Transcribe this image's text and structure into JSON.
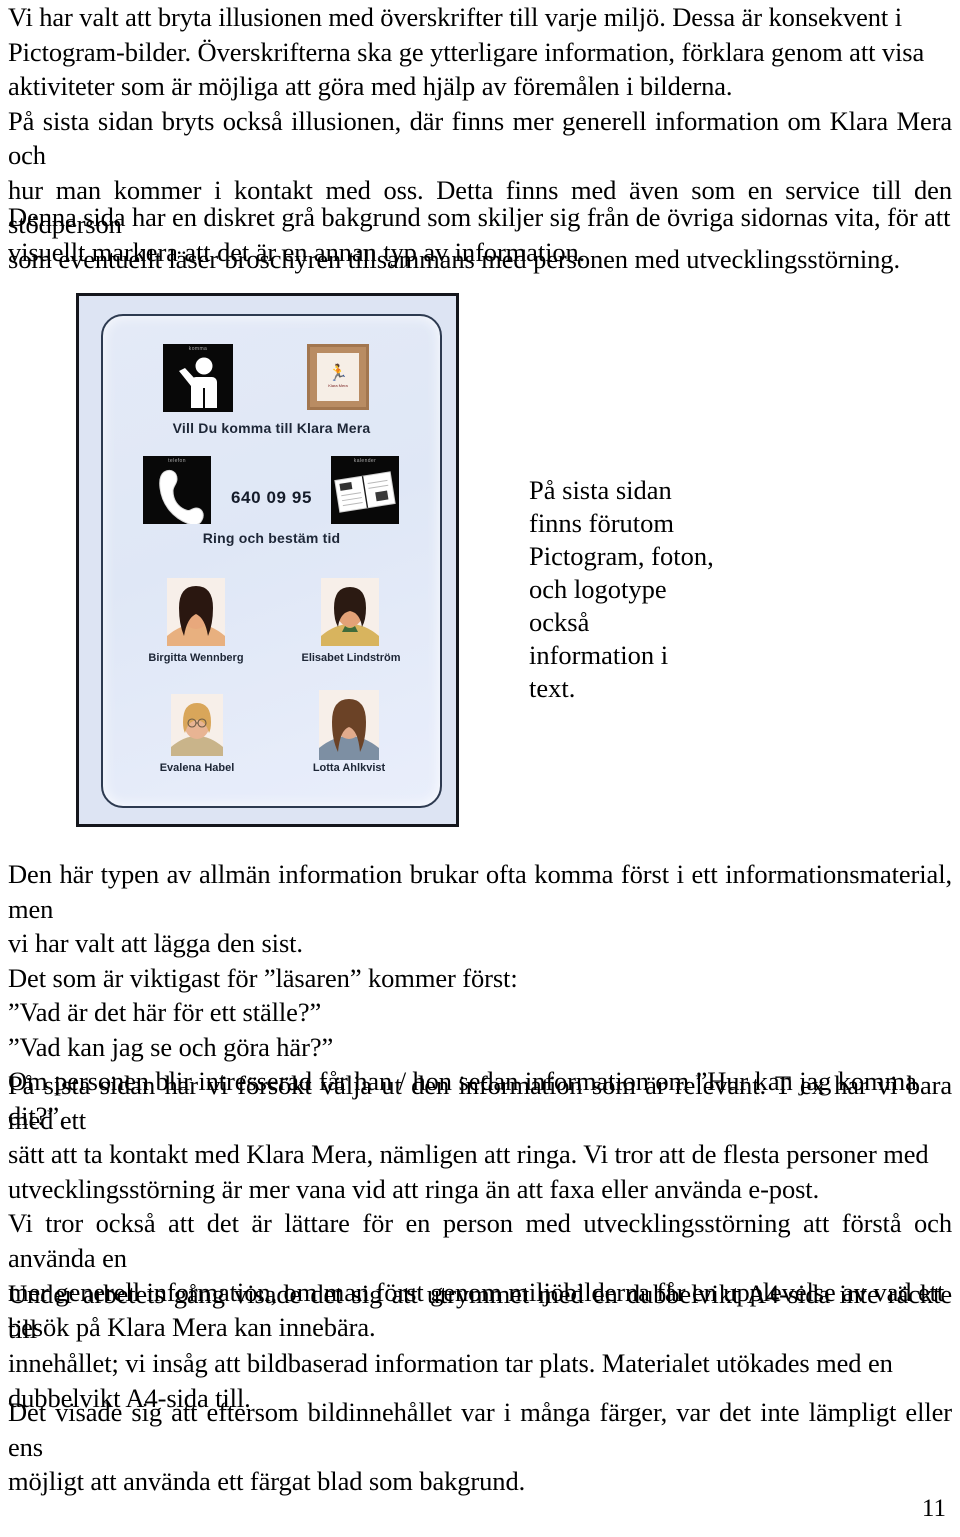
{
  "document": {
    "page_number": "11",
    "paragraphs": {
      "intro": [
        "Vi har valt att bryta illusionen med överskrifter till varje miljö. Dessa är konsekvent i",
        "Pictogram-bilder. Överskrifterna ska ge ytterligare information, förklara genom att visa",
        "aktiviteter som är möjliga att göra med hjälp av föremålen i bilderna.",
        "På sista sidan bryts också illusionen, där finns mer generell information om Klara Mera och",
        "hur man kommer i kontakt med oss. Detta finns med även som en service till den stödperson",
        "som eventuellt läser broschyren tillsammans med personen med utvecklingsstörning."
      ],
      "gray_background": [
        "Denna sida har en diskret grå bakgrund som skiljer sig från de övriga sidornas vita, för att",
        "visuellt markera att det är en annan typ av information."
      ],
      "reader_first": [
        "Den här typen av allmän information brukar ofta komma först i ett informationsmaterial, men",
        "vi har valt att lägga den sist.",
        "Det som är viktigast för ”läsaren” kommer först:",
        "”Vad är det här för ett ställe?”",
        "”Vad kan jag se och göra här?”",
        "Om personen blir intresserad får han / hon sedan information om ”Hur kan jag komma dit?”."
      ],
      "relevant_info": [
        "På sista sidan har vi försökt välja ut den information som är relevant. T ex har vi bara med ett",
        "sätt att ta kontakt med Klara Mera, nämligen att ringa. Vi tror att de flesta personer med",
        "utvecklingsstörning är mer vana vid att ringa än att faxa eller använda e-post.",
        "Vi tror också att det är lättare för en person med utvecklingsstörning att förstå och använda en",
        "mer generell information, om man först genom miljöbilderna får en upplevelse av vad ett",
        "besök på Klara Mera kan innebära."
      ],
      "work_progress": [
        "Under arbetets gång visade det sig att utrymmet med en dubbelvikt A4-sida inte räckte till",
        "innehållet; vi insåg att bildbaserad information tar plats. Materialet utökades med en",
        "dubbelvikt A4-sida till."
      ],
      "colors": [
        "Det visade sig att eftersom bildinnehållet var i många färger, var det inte lämpligt eller ens",
        "möjligt att använda ett färgat blad som bakgrund."
      ]
    },
    "side_caption": [
      "På sista sidan",
      "finns förutom",
      "Pictogram, foton,",
      "och logotype",
      "också",
      "information i",
      "text."
    ]
  },
  "figure": {
    "name": "klara-mera-brochure-last-page",
    "background_color": "#dde4f3",
    "border_color": "#14161c",
    "pictograms": [
      {
        "id": "person",
        "caption": "komma",
        "label": "person-waving-icon"
      },
      {
        "id": "logo-frame",
        "caption": "Klara Mera",
        "label": "framed-logo-icon"
      },
      {
        "id": "telephone",
        "caption": "telefon",
        "label": "telephone-icon"
      },
      {
        "id": "calendar",
        "caption": "kalender",
        "label": "calendar-icon"
      }
    ],
    "heading_1": "Vill Du komma till Klara Mera",
    "phone_number": "640 09 95",
    "heading_2": "Ring och bestäm tid",
    "staff": [
      {
        "name": "Birgitta Wennberg",
        "hair": "#2a1710",
        "skin": "#e8a87c",
        "shirt": "#e8b07f"
      },
      {
        "name": "Elisabet Lindström",
        "hair": "#2b1a12",
        "skin": "#e3a277",
        "shirt": "#d8b45e"
      },
      {
        "name": "Evalena Habel",
        "hair": "#d9a65a",
        "skin": "#e8b493",
        "shirt": "#c9b48a"
      },
      {
        "name": "Lotta Ahlkvist",
        "hair": "#6b4226",
        "skin": "#e2ab8c",
        "shirt": "#7d8fa3"
      }
    ]
  }
}
